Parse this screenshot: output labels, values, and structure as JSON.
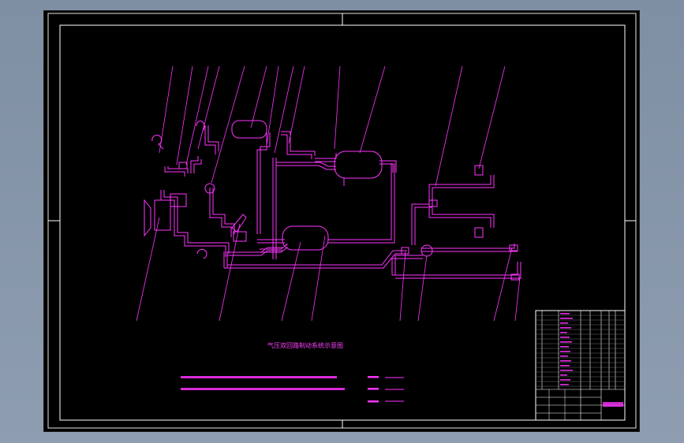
{
  "drawing": {
    "title": "气压双回路制动系统示意图",
    "colors": {
      "background": "#000000",
      "frame": "#ffffff",
      "pipe": "#ff33ff",
      "viewport_surround": "#8796aa"
    }
  },
  "callouts": {
    "top": [
      "",
      "",
      "",
      "",
      "",
      "",
      "",
      "",
      "",
      "",
      "",
      "",
      ""
    ],
    "bottom": [
      "",
      "",
      "",
      "",
      "",
      "",
      "",
      "",
      ""
    ]
  }
}
